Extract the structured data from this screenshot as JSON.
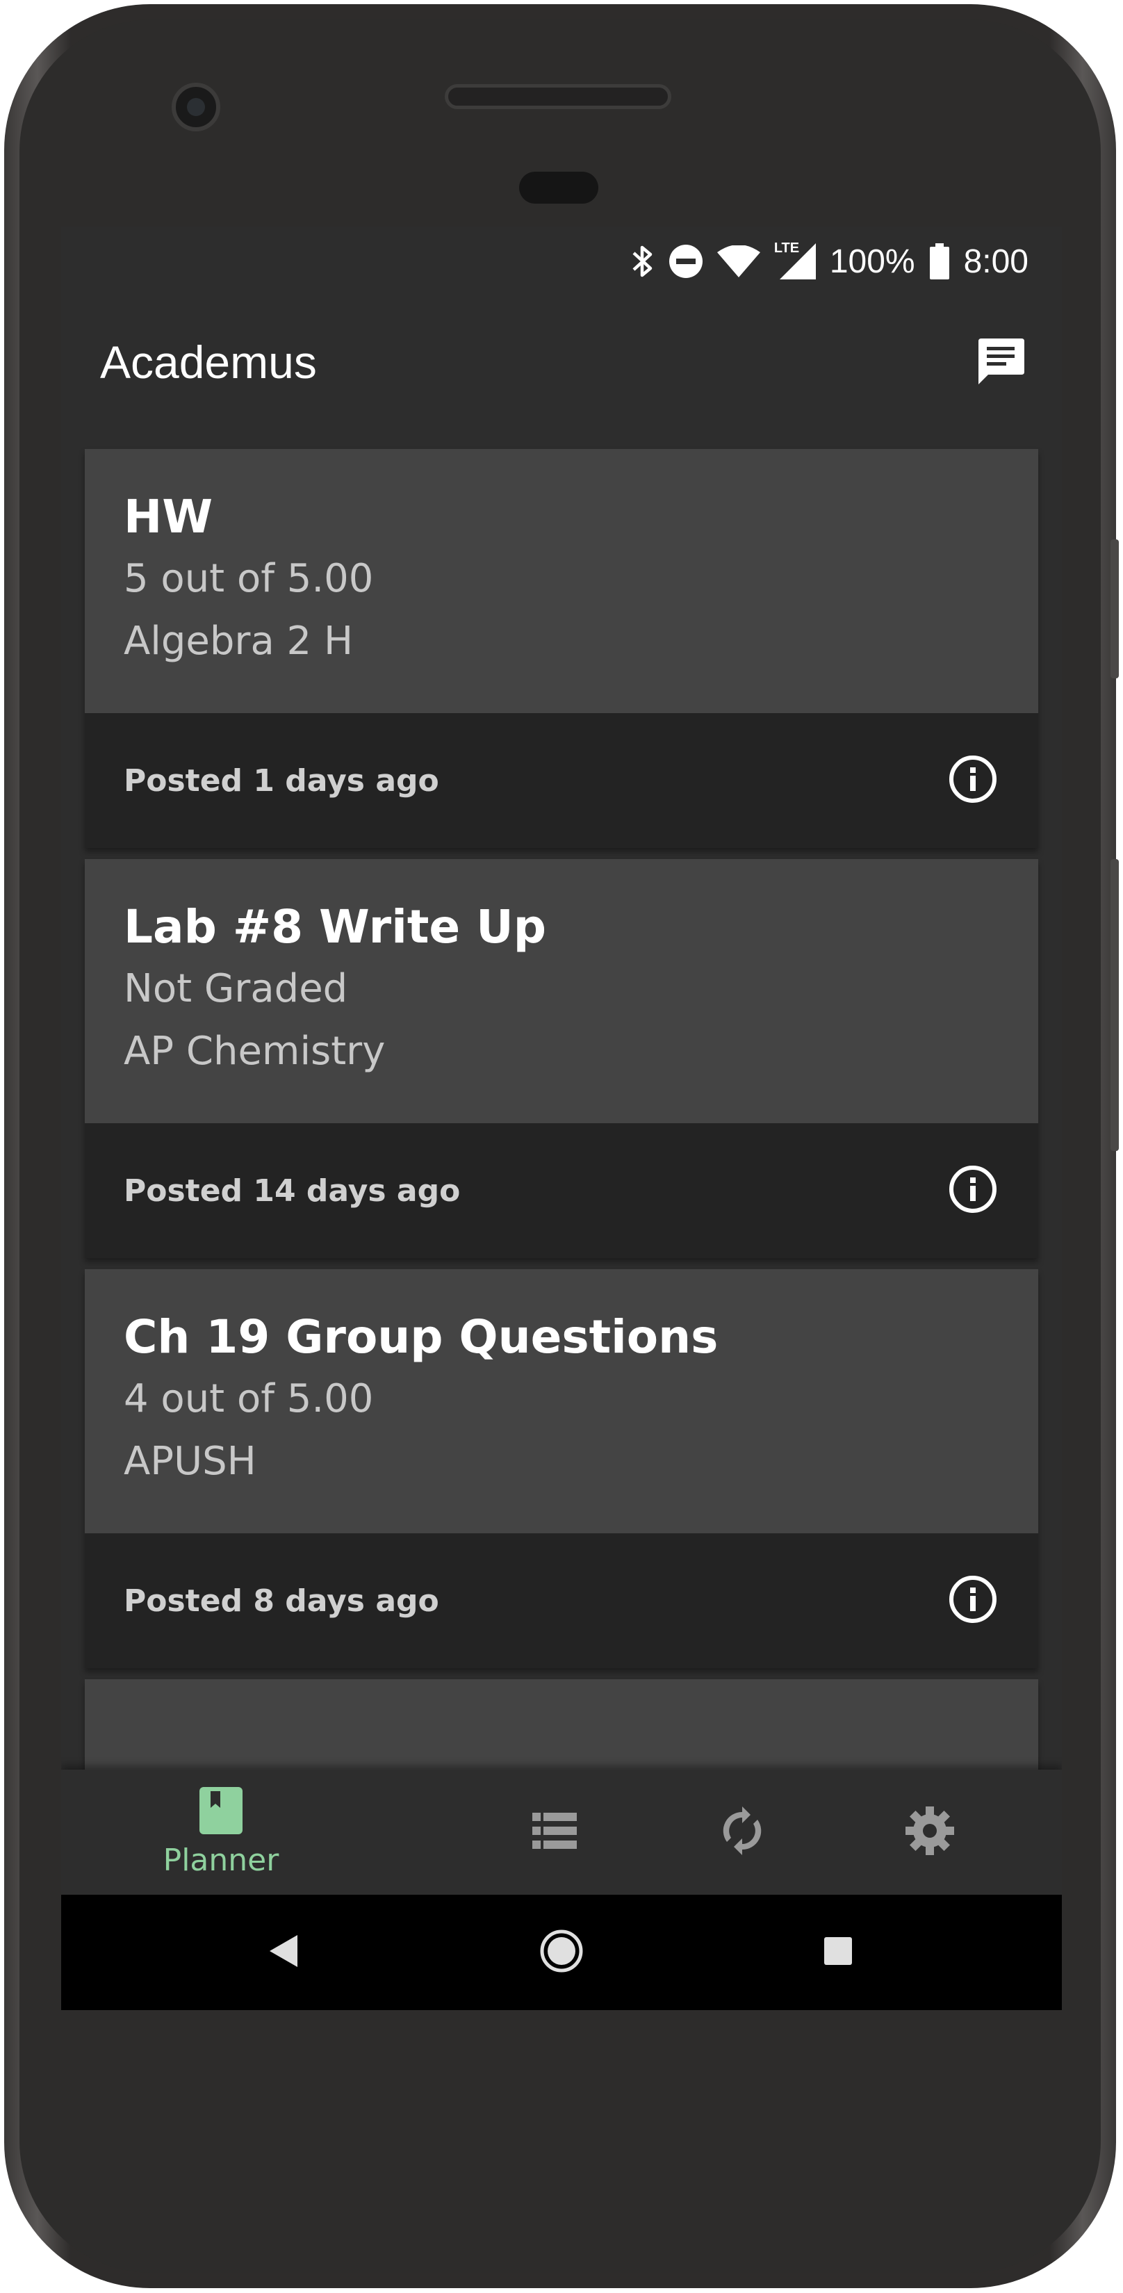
{
  "status_bar": {
    "battery_percent": "100%",
    "time": "8:00",
    "network_label": "LTE",
    "icons": [
      "bluetooth-icon",
      "do-not-disturb-icon",
      "wifi-icon",
      "lte-signal-icon",
      "battery-icon"
    ]
  },
  "app_bar": {
    "title": "Academus",
    "message_icon": "message-icon"
  },
  "cards": [
    {
      "title": "HW",
      "score": "5 out of 5.00",
      "course": "Algebra 2 H",
      "posted": "Posted 1 days ago"
    },
    {
      "title": "Lab #8 Write Up",
      "score": "Not Graded",
      "course": "AP Chemistry",
      "posted": "Posted 14 days ago"
    },
    {
      "title": "Ch 19 Group Questions",
      "score": "4 out of 5.00",
      "course": "APUSH",
      "posted": "Posted 8 days ago"
    }
  ],
  "bottom_nav": {
    "items": [
      {
        "label": "Planner",
        "icon": "book-icon",
        "active": true
      },
      {
        "label": "",
        "icon": "list-icon",
        "active": false
      },
      {
        "label": "",
        "icon": "sync-icon",
        "active": false
      },
      {
        "label": "",
        "icon": "gear-icon",
        "active": false
      }
    ]
  },
  "colors": {
    "background": "#2d2d2d",
    "card_top": "#444444",
    "card_bottom": "#232323",
    "accent": "#8fd19e",
    "inactive_icon": "#9a9a9a"
  }
}
